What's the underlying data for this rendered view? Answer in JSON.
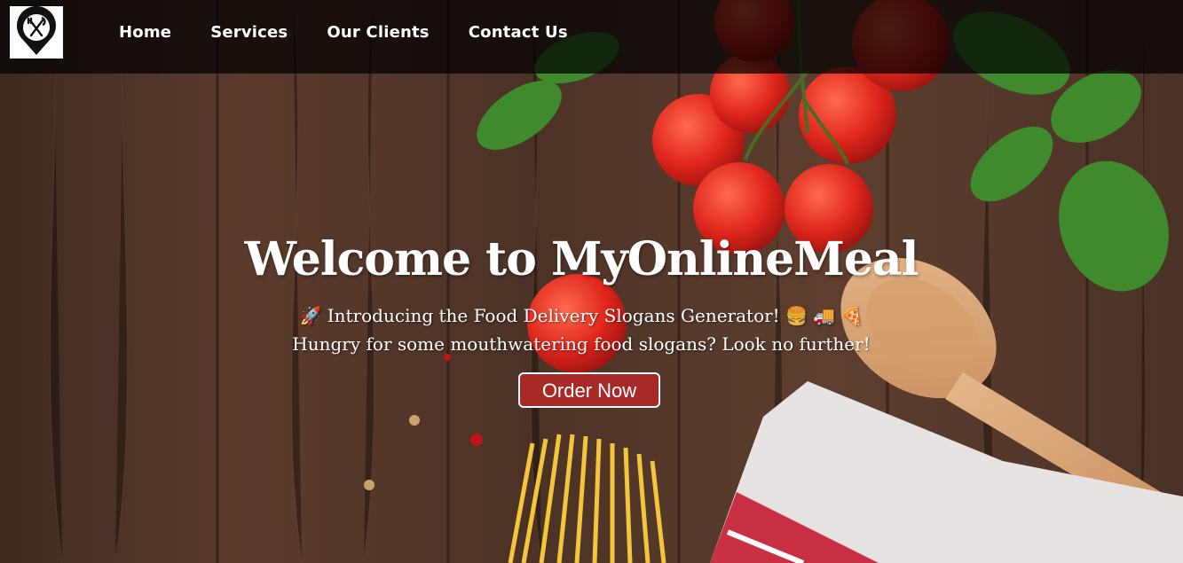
{
  "nav": {
    "logo_icon": "restaurant-location-pin-icon",
    "links": [
      {
        "label": "Home"
      },
      {
        "label": "Services"
      },
      {
        "label": "Our Clients"
      },
      {
        "label": "Contact Us"
      }
    ]
  },
  "hero": {
    "title": "Welcome to MyOnlineMeal",
    "intro": "🚀 Introducing the Food Delivery Slogans Generator! 🍔 🚚 🍕",
    "tagline": "Hungry for some mouthwatering food slogans? Look no further!",
    "button_label": "Order Now"
  },
  "colors": {
    "nav_bg": "#000000",
    "button_bg": "#a72a27",
    "text": "#ffffff",
    "wood": "#5a3a2a"
  }
}
